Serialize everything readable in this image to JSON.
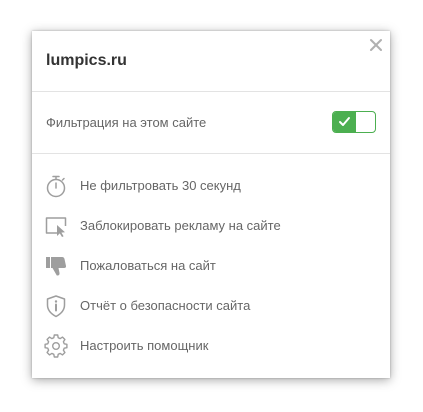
{
  "popup": {
    "site_name": "lumpics.ru",
    "close_icon": "close-icon",
    "filter": {
      "label": "Фильтрация на этом сайте",
      "enabled": true,
      "toggle_color": "#4caf50"
    },
    "menu": [
      {
        "label": "Не фильтровать 30 секунд",
        "icon": "stopwatch-icon"
      },
      {
        "label": "Заблокировать рекламу на сайте",
        "icon": "block-ad-icon"
      },
      {
        "label": "Пожаловаться на сайт",
        "icon": "thumbs-down-icon"
      },
      {
        "label": "Отчёт о безопасности сайта",
        "icon": "shield-info-icon"
      },
      {
        "label": "Настроить помощник",
        "icon": "gear-icon"
      }
    ]
  },
  "colors": {
    "text": "#666666",
    "title": "#333333",
    "icon": "#9e9e9e",
    "accent": "#4caf50"
  }
}
